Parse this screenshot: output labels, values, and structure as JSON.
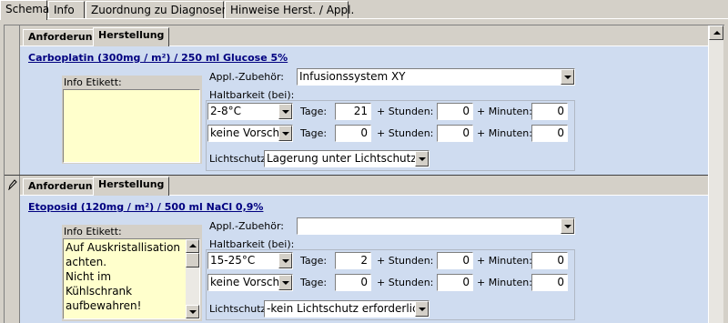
{
  "tabs": [
    "Schema",
    "Info",
    "Zuordnung zu Diagnosen",
    "Hinweise Herst. / Appl."
  ],
  "labels": {
    "anforderung": "Anforderung",
    "herstellung": "Herstellung",
    "info_etikett": "Info Etikett:",
    "appl_zubehoer": "Appl.-Zubehör:",
    "haltbarkeit": "Haltbarkeit (bei):",
    "tage": "Tage:",
    "stunden": "+ Stunden:",
    "minuten": "+ Minuten:",
    "lichtschutz": "Lichtschutz:"
  },
  "records": [
    {
      "title": "Carboplatin (300mg / m²) / 250 ml Glucose 5%",
      "info_text": "",
      "appl_zubehoer": "Infusionssystem XY",
      "rows": [
        {
          "temp": "2-8°C",
          "tage": "21",
          "stunden": "0",
          "minuten": "0"
        },
        {
          "temp": "keine Vorschr",
          "tage": "0",
          "stunden": "0",
          "minuten": "0"
        }
      ],
      "lichtschutz": "Lagerung unter Lichtschutz"
    },
    {
      "title": "Etoposid (120mg / m²) / 500 ml NaCl 0,9%",
      "info_text": "Auf Auskristallisation achten.\nNicht im  Kühlschrank aufbewahren!",
      "appl_zubehoer": "",
      "rows": [
        {
          "temp": "15-25°C",
          "tage": "2",
          "stunden": "0",
          "minuten": "0"
        },
        {
          "temp": "keine Vorschr",
          "tage": "0",
          "stunden": "0",
          "minuten": "0"
        }
      ],
      "lichtschutz": "-kein Lichtschutz erforderlich-"
    }
  ]
}
